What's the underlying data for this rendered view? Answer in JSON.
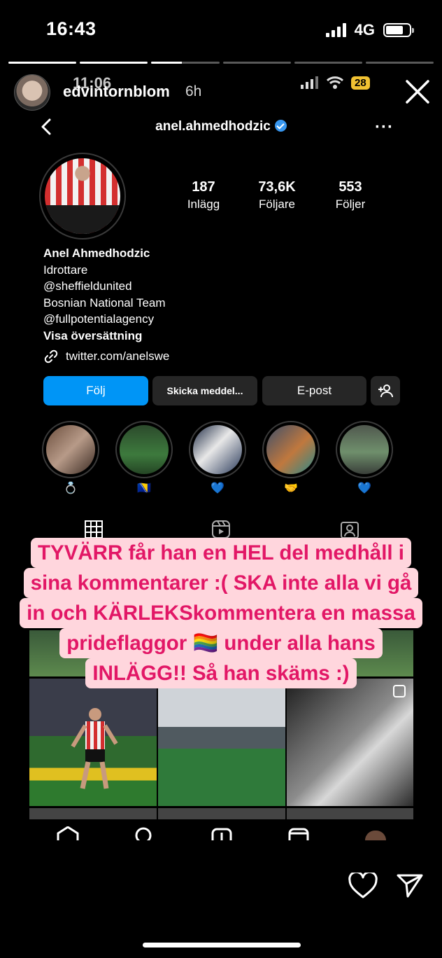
{
  "status_bar": {
    "time": "16:43",
    "network": "4G"
  },
  "story": {
    "progress_fraction": [
      1,
      1,
      0.45,
      0,
      0,
      0
    ],
    "username": "edvintornblom",
    "age": "6h",
    "inner_time": "11:06",
    "inner_battery": "28"
  },
  "profile": {
    "username": "anel.ahmedhodzic",
    "stats": [
      {
        "num": "187",
        "label": "Inlägg"
      },
      {
        "num": "73,6K",
        "label": "Följare"
      },
      {
        "num": "553",
        "label": "Följer"
      }
    ],
    "name": "Anel Ahmedhodzic",
    "bio": [
      "Idrottare",
      "@sheffieldunited",
      "Bosnian National Team",
      "@fullpotentialagency"
    ],
    "translate": "Visa översättning",
    "link": "twitter.com/anelswe",
    "buttons": {
      "follow": "Följ",
      "message": "Skicka meddel...",
      "email": "E-post"
    },
    "highlights": [
      "💍",
      "🇧🇦",
      "💙",
      "🤝",
      "💙"
    ]
  },
  "caption": [
    "TYVÄRR får han en HEL del medhåll i",
    "sina kommentarer :( SKA inte alla vi gå",
    "in och KÄRLEKSkommentera en massa",
    "prideflaggor 🏳️‍🌈 under alla hans",
    "INLÄGG!! Så han skäms :)"
  ],
  "colors": {
    "follow_blue": "#0095f6",
    "caption_bg": "#ffd6dd",
    "caption_text": "#e21766"
  }
}
